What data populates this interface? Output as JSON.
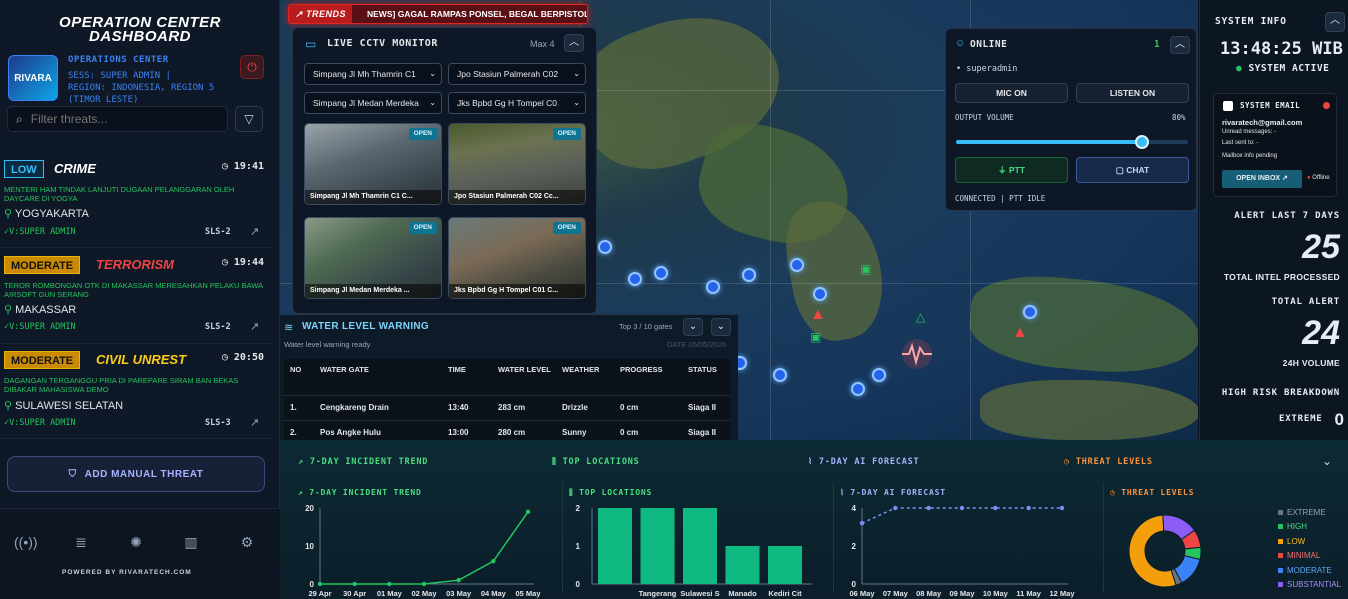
{
  "sidebar": {
    "title_line1": "OPERATION CENTER",
    "title_line2": "DASHBOARD",
    "logo_text": "RIVARA",
    "ops_label": "OPERATIONS CENTER",
    "session": "SESS: SUPER ADMIN |",
    "region": "REGION: INDONESIA, REGION 5",
    "region2": "(TIMOR LESTE)",
    "search_placeholder": "Filter threats...",
    "threats": [
      {
        "level": "LOW",
        "type": "CRIME",
        "time": "19:41",
        "desc": "MENTERI HAM TINDAK LANJUTI DUGAAN PELANGGARAN OLEH DAYCARE DI YOGYA",
        "location": "YOGYAKARTA",
        "verified": "V:SUPER ADMIN",
        "sls": "SLS-2"
      },
      {
        "level": "MODERATE",
        "type": "TERRORISM",
        "time": "19:44",
        "desc": "TEROR ROMBONGAN OTK DI MAKASSAR MERESAHKAN PELAKU BAWA AIRSOFT GUN SERANG",
        "location": "MAKASSAR",
        "verified": "V:SUPER ADMIN",
        "sls": "SLS-2"
      },
      {
        "level": "MODERATE",
        "type": "CIVIL UNREST",
        "time": "20:50",
        "desc": "DAGANGAN TERGANGGU PRIA DI PAREPARE SIRAM BAN BEKAS DIBAKAR MAHASISWA DEMO",
        "location": "SULAWESI SELATAN",
        "verified": "V:SUPER ADMIN",
        "sls": "SLS-3"
      }
    ],
    "add_button": "ADD MANUAL THREAT",
    "powered": "POWERED BY RIVARATECH.COM"
  },
  "trends": {
    "label": "TRENDS",
    "text": "NEWS] GAGAL RAMPAS PONSEL, BEGAL BERPISTOL TEMBAK WARGA DI BANDUNG (DETIKJABAR JUMAT, 24 APR 2026 09:46 WIB) • [NEWS] [TREND] SPPG"
  },
  "cctv": {
    "title": "LIVE CCTV MONITOR",
    "max": "Max 4",
    "cameras": [
      {
        "select": "Simpang Jl Mh Thamrin C1",
        "label": "Simpang Jl Mh Thamrin C1 C...",
        "status": "OPEN"
      },
      {
        "select": "Jpo Stasiun Palmerah C02",
        "label": "Jpo Stasiun Palmerah C02 Cc...",
        "status": "OPEN"
      },
      {
        "select": "Simpang Jl Medan Merdeka",
        "label": "Simpang Jl Medan Merdeka ...",
        "status": "OPEN"
      },
      {
        "select": "Jks Bpbd Gg H Tompel C0",
        "label": "Jks Bpbd Gg H Tompel C01 C...",
        "status": "OPEN"
      }
    ]
  },
  "online": {
    "title": "ONLINE",
    "count": "1",
    "user": "• superadmin",
    "mic": "MIC ON",
    "listen": "LISTEN ON",
    "volume_label": "OUTPUT VOLUME",
    "volume_value": "80%",
    "volume": 0.8,
    "ptt": "PTT",
    "chat": "CHAT",
    "status": "CONNECTED | PTT IDLE"
  },
  "water": {
    "title": "WATER LEVEL WARNING",
    "subtitle": "Water level warning ready",
    "gates": "Top 3 / 10 gates",
    "date": "DATE 05/05/2026",
    "headers": [
      "NO",
      "WATER GATE",
      "TIME",
      "WATER LEVEL",
      "WEATHER",
      "PROGRESS",
      "STATUS"
    ],
    "rows": [
      [
        "1.",
        "Cengkareng Drain",
        "13:40",
        "283 cm",
        "Drizzle",
        "0 cm",
        "Siaga II"
      ],
      [
        "2.",
        "Pos Angke Hulu",
        "13:00",
        "280 cm",
        "Sunny",
        "0 cm",
        "Siaga II"
      ]
    ]
  },
  "system": {
    "title": "SYSTEM INFO",
    "clock": "13:48:25 WIB",
    "active": "SYSTEM ACTIVE",
    "email_title": "SYSTEM EMAIL",
    "email": "rivaratech@gmail.com",
    "unread": "Unread messages: -",
    "last": "Last sent to: -",
    "pending": "Mailbox info pending",
    "open_inbox": "OPEN INBOX",
    "offline": "Offline",
    "alert_label": "ALERT LAST 7 DAYS",
    "alert_value": "25",
    "alert_sub": "TOTAL INTEL PROCESSED",
    "total_label": "TOTAL ALERT",
    "total_value": "24",
    "total_sub": "24H VOLUME",
    "risk_label": "HIGH RISK BREAKDOWN",
    "extreme_label": "EXTREME",
    "extreme_value": "0"
  },
  "bottom_tabs": {
    "incident": "7-DAY INCIDENT TREND",
    "locations": "TOP LOCATIONS",
    "forecast": "7-DAY AI FORECAST",
    "threat": "THREAT LEVELS"
  },
  "chart_data": [
    {
      "type": "line",
      "title": "7-DAY INCIDENT TREND",
      "x": [
        "29 Apr",
        "30 Apr",
        "01 May",
        "02 May",
        "03 May",
        "04 May",
        "05 May"
      ],
      "values": [
        0,
        0,
        0,
        0,
        1,
        6,
        19
      ],
      "ylim": [
        0,
        20
      ],
      "yticks": [
        0,
        10,
        20
      ]
    },
    {
      "type": "bar",
      "title": "TOP LOCATIONS",
      "categories": [
        "Tangerang",
        "Sulawesi S",
        "Manado",
        "Kediri Cit"
      ],
      "values": [
        2,
        2,
        1,
        1
      ],
      "ylim": [
        0,
        2
      ],
      "yticks": [
        0,
        1,
        2
      ],
      "bars": [
        2,
        2,
        2,
        1,
        1
      ]
    },
    {
      "type": "line",
      "title": "7-DAY AI FORECAST",
      "x": [
        "06 May",
        "07 May",
        "08 May",
        "09 May",
        "10 May",
        "11 May",
        "12 May"
      ],
      "values": [
        3.2,
        4,
        4,
        4,
        4,
        4,
        4
      ],
      "ylim": [
        0,
        4
      ],
      "yticks": [
        0,
        2,
        4
      ]
    },
    {
      "type": "pie",
      "title": "THREAT LEVELS",
      "labels": [
        "EXTREME",
        "HIGH",
        "LOW",
        "MINIMAL",
        "MODERATE",
        "SUBSTANTIAL"
      ],
      "values": [
        0.5,
        1,
        10,
        1.5,
        2.5,
        3
      ]
    }
  ],
  "colors": {
    "low": "#38bdf8",
    "moderate": "#eab308",
    "extreme": "#6b7280",
    "high": "#22c55e",
    "lowpie": "#f59e0b",
    "minimal": "#ef4444",
    "mod": "#3b82f6",
    "sub": "#8b5cf6"
  }
}
